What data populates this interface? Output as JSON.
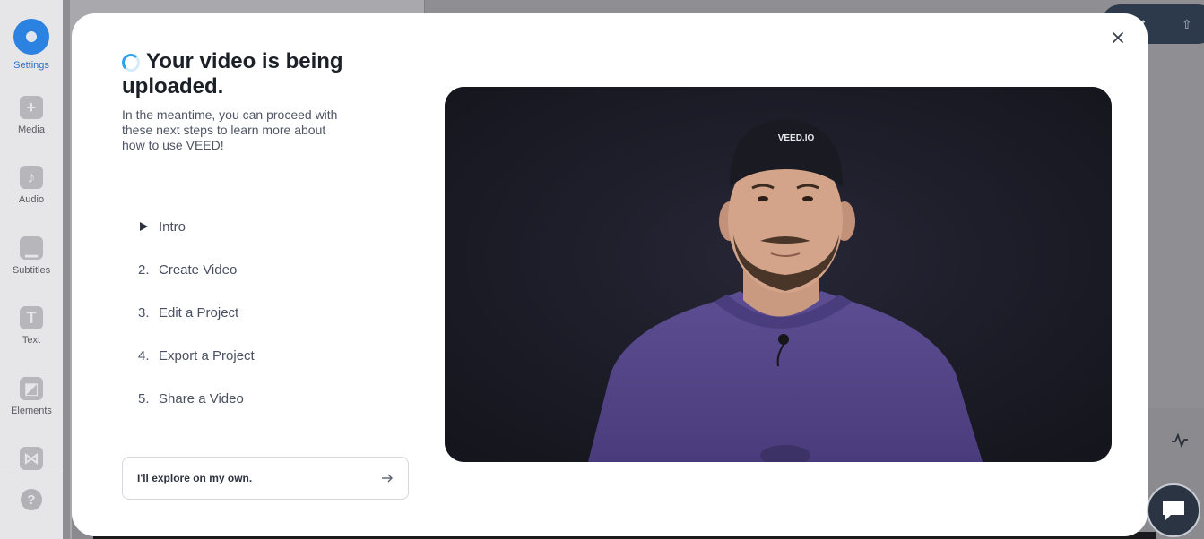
{
  "sidebar": {
    "items": [
      {
        "label": "Settings",
        "icon": "settings-icon",
        "active": true
      },
      {
        "label": "Media",
        "icon": "plus-icon"
      },
      {
        "label": "Audio",
        "icon": "music-note-icon"
      },
      {
        "label": "Subtitles",
        "icon": "subtitles-icon"
      },
      {
        "label": "Text",
        "icon": "text-icon"
      },
      {
        "label": "Elements",
        "icon": "elements-icon"
      },
      {
        "label": "",
        "icon": "transitions-icon"
      }
    ],
    "help_icon": "?"
  },
  "topbar": {
    "export_label": "ort"
  },
  "modal": {
    "heading": "Your video is being uploaded.",
    "subtext": "In the meantime, you can proceed with these next steps to learn more about how to use VEED!",
    "steps": [
      {
        "number": "",
        "label": "Intro",
        "playing": true
      },
      {
        "number": "2.",
        "label": "Create Video"
      },
      {
        "number": "3.",
        "label": "Edit a Project"
      },
      {
        "number": "4.",
        "label": "Export a Project"
      },
      {
        "number": "5.",
        "label": "Share a Video"
      }
    ],
    "explore_label": "I'll explore on my own.",
    "video_cap_text": "VEED.IO"
  },
  "colors": {
    "accent": "#2aa3ee",
    "heading": "#1b1f27",
    "sweater": "#5a4a8e"
  }
}
